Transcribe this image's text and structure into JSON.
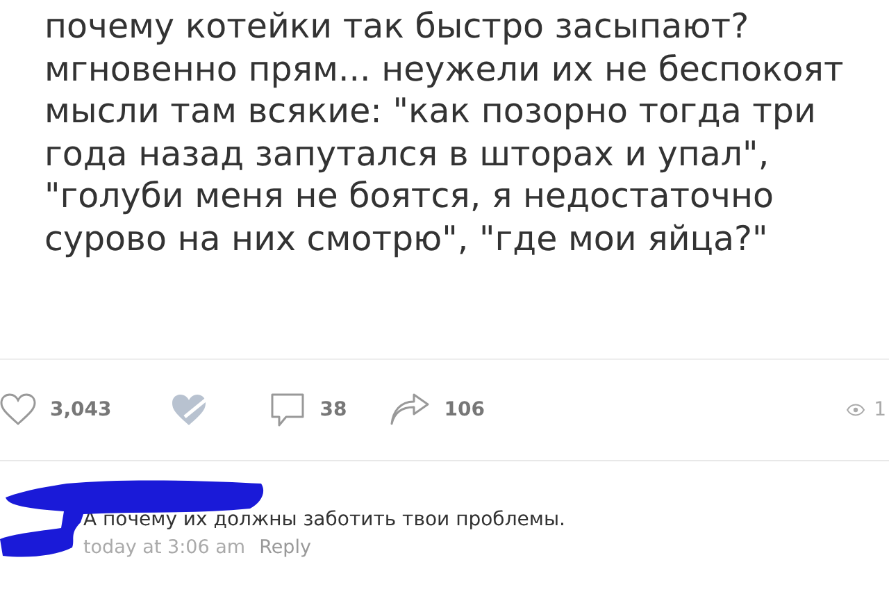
{
  "post": {
    "text": "почему котейки так быстро засыпают?\nмгновенно прям... неужели их не беспокоят\nмысли там всякие: \"как позорно тогда три\nгода назад запутался в шторах и упал\",\n\"голуби меня не боятся, я недостаточно\nсурово на них смотрю\", \"где мои яйца?\""
  },
  "actions": {
    "likes": "3,043",
    "comments": "38",
    "shares": "106",
    "views": "1"
  },
  "comment": {
    "text": "А почему их должны заботить твои проблемы.",
    "time": "today at 3:06 am",
    "reply": "Reply"
  }
}
